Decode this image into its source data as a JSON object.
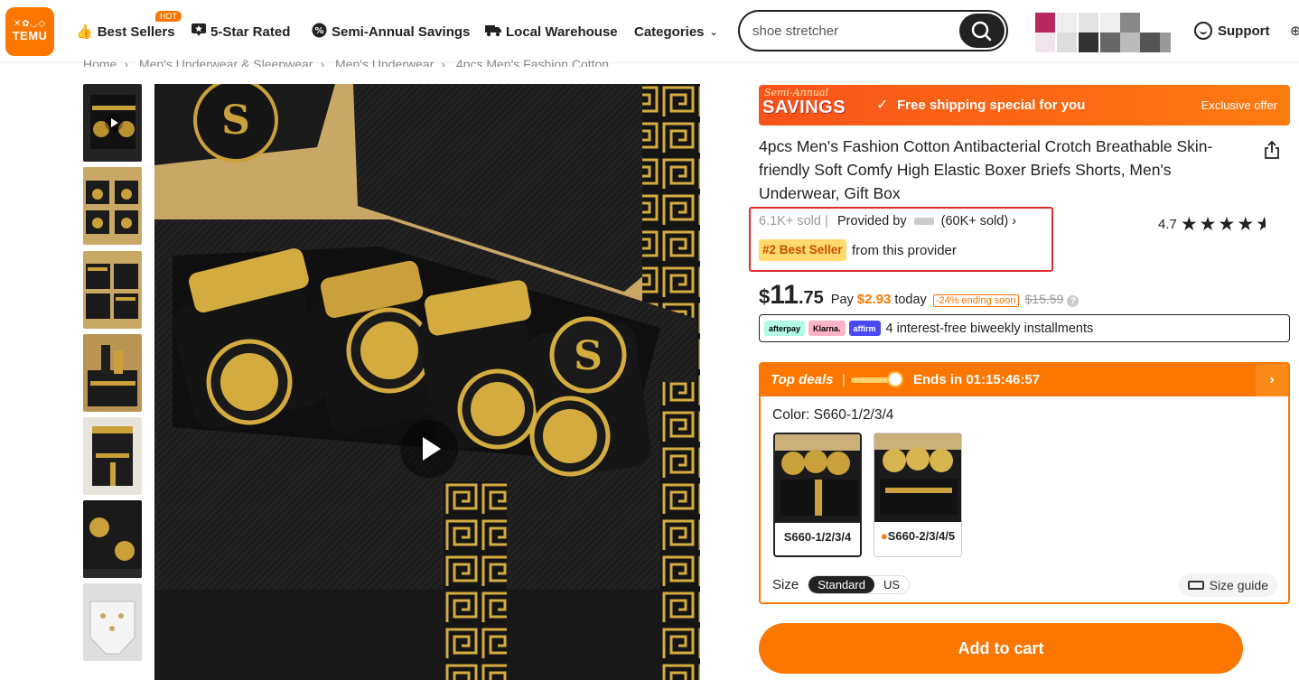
{
  "nav": {
    "logo_line1": "TEMU",
    "logo_line2": "TEMU",
    "best_sellers": "Best Sellers",
    "hot_badge": "HOT",
    "five_star": "5-Star Rated",
    "semi_annual": "Semi-Annual Savings",
    "local_warehouse": "Local Warehouse",
    "categories": "Categories",
    "search_value": "shoe stretcher",
    "support": "Support"
  },
  "breadcrumb": [
    "Home",
    "Men's Underwear & Sleepwear",
    "Men's Underwear",
    "4pcs Men's Fashion Cotton ..."
  ],
  "promo": {
    "badge_line1": "Semi-Annual",
    "badge_line2": "SAVINGS",
    "message": "Free shipping special for you",
    "exclusive": "Exclusive offer"
  },
  "product": {
    "title": "4pcs Men's Fashion Cotton Antibacterial Crotch Breathable Skin-friendly Soft Comfy High Elastic Boxer Briefs Shorts, Men's Underwear, Gift Box",
    "sold": "6.1K+ sold",
    "provided_by": "Provided by",
    "provider_sold": "(60K+ sold)",
    "best_seller_badge": "#2 Best Seller",
    "from_provider": "from this provider",
    "rating": "4.7",
    "rating_stars": 4.7
  },
  "price": {
    "currency": "$",
    "dollars": "11",
    "cents": ".75",
    "pay_label": "Pay",
    "pay_amount": "$2.93",
    "today": "today",
    "discount": "-24% ending soon",
    "original": "$15.59"
  },
  "installments": {
    "afterpay": "afterpay",
    "klarna": "Klarna.",
    "affirm": "affirm",
    "text": "4 interest-free biweekly installments"
  },
  "deals": {
    "label": "Top deals",
    "divider": "|",
    "ends": "Ends in 01:15:46:57",
    "color_label": "Color: S660-1/2/3/4",
    "variants": [
      {
        "label": "S660-1/2/3/4"
      },
      {
        "label": "S660-2/3/4/5"
      }
    ],
    "size_label": "Size",
    "size_options": [
      "Standard",
      "US"
    ],
    "size_guide": "Size guide"
  },
  "add_to_cart": "Add to cart",
  "colors": {
    "accent": "#fb7701",
    "highlight_box": "#e02b2b",
    "best_seller_bg": "#ffd86e"
  }
}
